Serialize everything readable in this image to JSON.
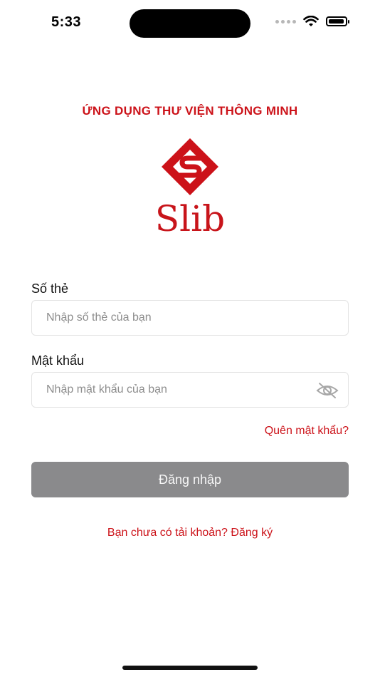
{
  "status_bar": {
    "time": "5:33"
  },
  "header": {
    "app_heading": "ỨNG DỤNG THƯ VIỆN THÔNG MINH",
    "logo_text": "Slib"
  },
  "form": {
    "card_number": {
      "label": "Số thẻ",
      "value": "",
      "placeholder": "Nhập số thẻ của bạn"
    },
    "password": {
      "label": "Mật khẩu",
      "value": "",
      "placeholder": "Nhập mật khẩu của bạn",
      "visibility_icon": "eye-slash-icon"
    },
    "forgot_password_label": "Quên mật khẩu?",
    "login_button_label": "Đăng nhập",
    "register_prompt": "Bạn chưa có tải khoản? Đăng ký"
  },
  "colors": {
    "brand_red": "#cc1219",
    "disabled_button": "#8a8a8c"
  }
}
